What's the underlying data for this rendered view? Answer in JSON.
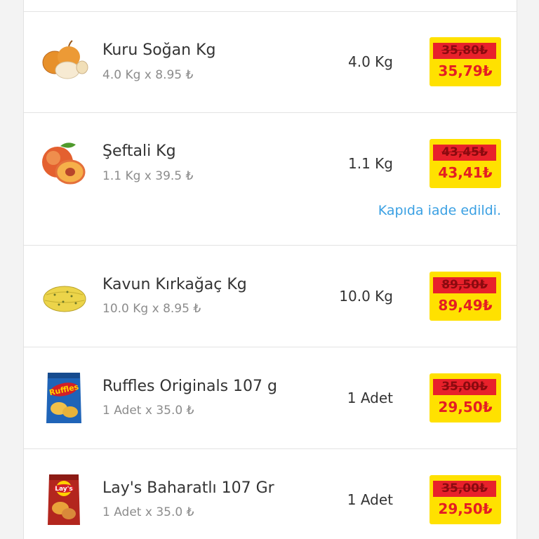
{
  "currency_symbol": "₺",
  "colors": {
    "badge_bg": "#ffe100",
    "old_price_bg": "#e8212b",
    "new_price": "#e41d23",
    "note": "#3aa0e3"
  },
  "items": [
    {
      "name": "Kuru Soğan Kg",
      "unit_detail": "4.0 Kg x 8.95 ₺",
      "quantity": "4.0 Kg",
      "old_price": "35,80₺",
      "new_price": "35,79₺",
      "icon": "onion-image"
    },
    {
      "name": "Şeftali Kg",
      "unit_detail": "1.1 Kg x 39.5 ₺",
      "quantity": "1.1 Kg",
      "old_price": "43,45₺",
      "new_price": "43,41₺",
      "note": "Kapıda iade edildi.",
      "icon": "peach-image"
    },
    {
      "name": "Kavun Kırkağaç Kg",
      "unit_detail": "10.0 Kg x 8.95 ₺",
      "quantity": "10.0 Kg",
      "old_price": "89,50₺",
      "new_price": "89,49₺",
      "icon": "melon-image"
    },
    {
      "name": "Ruffles Originals 107 g",
      "unit_detail": "1 Adet x 35.0 ₺",
      "quantity": "1 Adet",
      "old_price": "35,00₺",
      "new_price": "29,50₺",
      "icon": "ruffles-bag-image"
    },
    {
      "name": "Lay's Baharatlı 107 Gr",
      "unit_detail": "1 Adet x 35.0 ₺",
      "quantity": "1 Adet",
      "old_price": "35,00₺",
      "new_price": "29,50₺",
      "icon": "lays-bag-image"
    }
  ]
}
